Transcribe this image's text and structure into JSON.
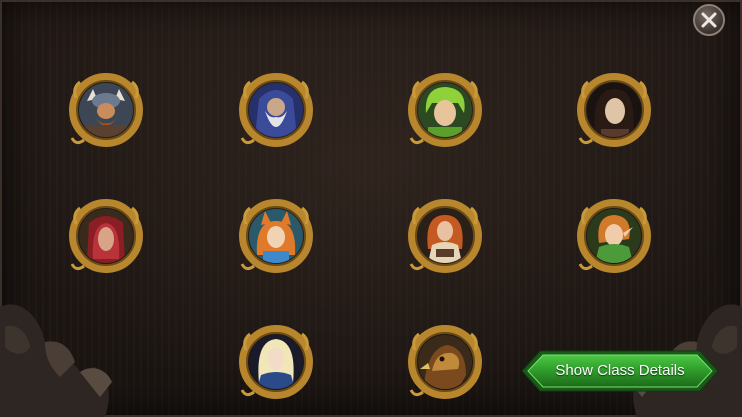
{
  "dialog": {
    "close_icon": "close-icon"
  },
  "class_portraits": [
    {
      "name": "dwarf-viking",
      "colors": {
        "skin": "#c98c5a",
        "hair": "#a0521e",
        "accent": "#6b7a8f",
        "bg": "#3c4654"
      }
    },
    {
      "name": "old-wizard",
      "colors": {
        "skin": "#caa68a",
        "hair": "#e4e4e8",
        "accent": "#3a4b9a",
        "bg": "#26306a"
      }
    },
    {
      "name": "green-haired-youth",
      "colors": {
        "skin": "#e8c49c",
        "hair": "#8fd13a",
        "accent": "#5aa02a",
        "bg": "#2c4a22"
      }
    },
    {
      "name": "dark-haired-man",
      "colors": {
        "skin": "#e0c4a8",
        "hair": "#2a1a14",
        "accent": "#5a3a2a",
        "bg": "#1a1210"
      }
    },
    {
      "name": "red-hooded-figure",
      "colors": {
        "skin": "#d7a487",
        "hair": "#b8343a",
        "accent": "#8a1e24",
        "bg": "#3a2a1c"
      }
    },
    {
      "name": "fox-eared-girl",
      "colors": {
        "skin": "#f0d2b4",
        "hair": "#e07a2a",
        "accent": "#3c8acb",
        "bg": "#2a5a6a"
      }
    },
    {
      "name": "red-haired-maiden",
      "colors": {
        "skin": "#e9c0a0",
        "hair": "#c45a22",
        "accent": "#e6d6b8",
        "bg": "#2a2018"
      }
    },
    {
      "name": "elf-archer",
      "colors": {
        "skin": "#f0ccaa",
        "hair": "#d07a2a",
        "accent": "#4c9a3a",
        "bg": "#2a3a1a"
      }
    },
    {
      "name": "blond-elf-knight",
      "colors": {
        "skin": "#f2dcc8",
        "hair": "#f0e6b8",
        "accent": "#2a4a8a",
        "bg": "#1a1a2a"
      }
    },
    {
      "name": "griffin",
      "colors": {
        "skin": "#c08a3a",
        "hair": "#7a4a1e",
        "accent": "#e0c060",
        "bg": "#3a2a1a"
      }
    }
  ],
  "actions": {
    "show_class_details": "Show Class Details"
  },
  "colors": {
    "frame_gold": "#b8862c",
    "button_green": "#2e9a2a"
  }
}
